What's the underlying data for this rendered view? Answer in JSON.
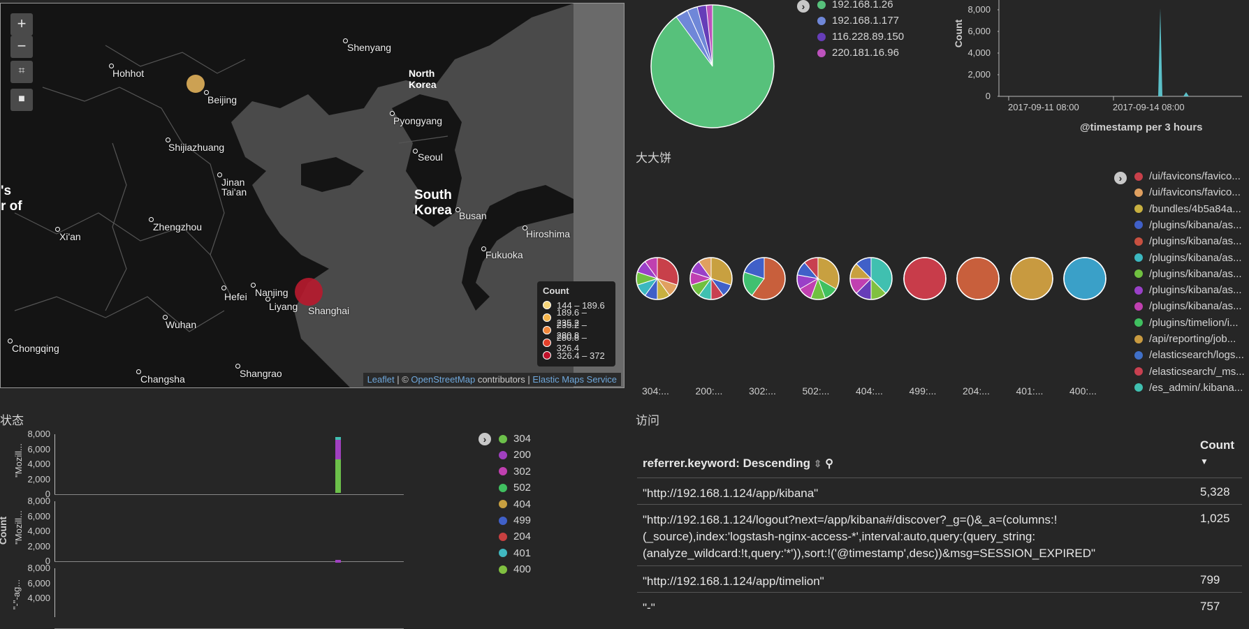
{
  "map": {
    "controls": {
      "zoom_in": "+",
      "zoom_out": "−"
    },
    "cities": [
      {
        "name": "Hohhot"
      },
      {
        "name": "Beijing"
      },
      {
        "name": "Shenyang"
      },
      {
        "name": "Shijiazhuang"
      },
      {
        "name": "Jinan"
      },
      {
        "name": "Tai'an"
      },
      {
        "name": "Zhengzhou"
      },
      {
        "name": "Xi'an"
      },
      {
        "name": "Pyongyang"
      },
      {
        "name": "Seoul"
      },
      {
        "name": "Busan"
      },
      {
        "name": "Hiroshima"
      },
      {
        "name": "Fukuoka"
      },
      {
        "name": "Hefei"
      },
      {
        "name": "Nanjing"
      },
      {
        "name": "Liyang"
      },
      {
        "name": "Shanghai"
      },
      {
        "name": "Wuhan"
      },
      {
        "name": "Chongqing"
      },
      {
        "name": "Changsha"
      },
      {
        "name": "Shangrao"
      }
    ],
    "countries": [
      {
        "name": "North\nKorea"
      },
      {
        "name": "South\nKorea"
      },
      {
        "name": "'s\nr of"
      }
    ],
    "legend": {
      "title": "Count",
      "ranges": [
        {
          "label": "144 – 189.6",
          "color": "#f6d57a"
        },
        {
          "label": "189.6 – 235.2",
          "color": "#f5b54c"
        },
        {
          "label": "235.2 – 280.8",
          "color": "#f2873a"
        },
        {
          "label": "280.8 – 326.4",
          "color": "#e3402a"
        },
        {
          "label": "326.4 – 372",
          "color": "#c0112a"
        }
      ]
    },
    "attribution": {
      "leaflet": "Leaflet",
      "sep1": " | © ",
      "osm": "OpenStreetMap",
      "mid": " contributors | ",
      "ems": "Elastic Maps Service"
    }
  },
  "ip_pie": {
    "legend": [
      {
        "label": "192.168.1.26",
        "color": "#57c17b"
      },
      {
        "label": "192.168.1.177",
        "color": "#6f87d8"
      },
      {
        "label": "116.228.89.150",
        "color": "#663db8"
      },
      {
        "label": "220.181.16.96",
        "color": "#bc52bc"
      }
    ]
  },
  "timeline": {
    "ylabel": "Count",
    "yticks": [
      "8,000",
      "6,000",
      "4,000",
      "2,000",
      "0"
    ],
    "xticks": [
      "2017-09-11 08:00",
      "2017-09-14 08:00"
    ],
    "xlabel": "@timestamp per 3 hours"
  },
  "bigpie": {
    "title": "大大饼",
    "pie_labels": [
      "304:...",
      "200:...",
      "302:...",
      "502:...",
      "404:...",
      "499:...",
      "204:...",
      "401:...",
      "400:..."
    ],
    "legend": [
      {
        "label": "/ui/favicons/favico...",
        "color": "#c8404a"
      },
      {
        "label": "/ui/favicons/favico...",
        "color": "#e0a060"
      },
      {
        "label": "/bundles/4b5a84a...",
        "color": "#c8b040"
      },
      {
        "label": "/plugins/kibana/as...",
        "color": "#4060c8"
      },
      {
        "label": "/plugins/kibana/as...",
        "color": "#c85040"
      },
      {
        "label": "/plugins/kibana/as...",
        "color": "#3cb8c0"
      },
      {
        "label": "/plugins/kibana/as...",
        "color": "#70c040"
      },
      {
        "label": "/plugins/kibana/as...",
        "color": "#9a40c8"
      },
      {
        "label": "/plugins/kibana/as...",
        "color": "#c040b0"
      },
      {
        "label": "/plugins/timelion/i...",
        "color": "#40c060"
      },
      {
        "label": "/api/reporting/job...",
        "color": "#c89a40"
      },
      {
        "label": "/elasticsearch/logs...",
        "color": "#4070c8"
      },
      {
        "label": "/elasticsearch/_ms...",
        "color": "#c84050"
      },
      {
        "label": "/es_admin/.kibana...",
        "color": "#40c0b0"
      }
    ]
  },
  "status": {
    "title": "状态",
    "ylabel": "Count",
    "yticks": [
      "8,000",
      "6,000",
      "4,000",
      "2,000",
      "0"
    ],
    "row_labels": [
      "\"Mozill...",
      "\"Mozill...",
      "\"-\"-ag..."
    ],
    "legend": [
      {
        "label": "304",
        "color": "#6cc04a"
      },
      {
        "label": "200",
        "color": "#a040c0"
      },
      {
        "label": "302",
        "color": "#c040b0"
      },
      {
        "label": "502",
        "color": "#40c060"
      },
      {
        "label": "404",
        "color": "#c8a040"
      },
      {
        "label": "499",
        "color": "#4060c8"
      },
      {
        "label": "204",
        "color": "#c84040"
      },
      {
        "label": "401",
        "color": "#40b8c0"
      },
      {
        "label": "400",
        "color": "#80c040"
      }
    ]
  },
  "access": {
    "title": "访问",
    "col1": "referrer.keyword: Descending",
    "col2": "Count",
    "rows": [
      {
        "ref": "\"http://192.168.1.124/app/kibana\"",
        "count": "5,328"
      },
      {
        "ref": "\"http://192.168.1.124/logout?next=/app/kibana#/discover?_g=()&_a=(columns:!(_source),index:'logstash-nginx-access-*',interval:auto,query:(query_string:(analyze_wildcard:!t,query:'*')),sort:!('@timestamp',desc))&msg=SESSION_EXPIRED\"",
        "count": "1,025"
      },
      {
        "ref": "\"http://192.168.1.124/app/timelion\"",
        "count": "799"
      },
      {
        "ref": "\"-\"",
        "count": "757"
      }
    ]
  }
}
